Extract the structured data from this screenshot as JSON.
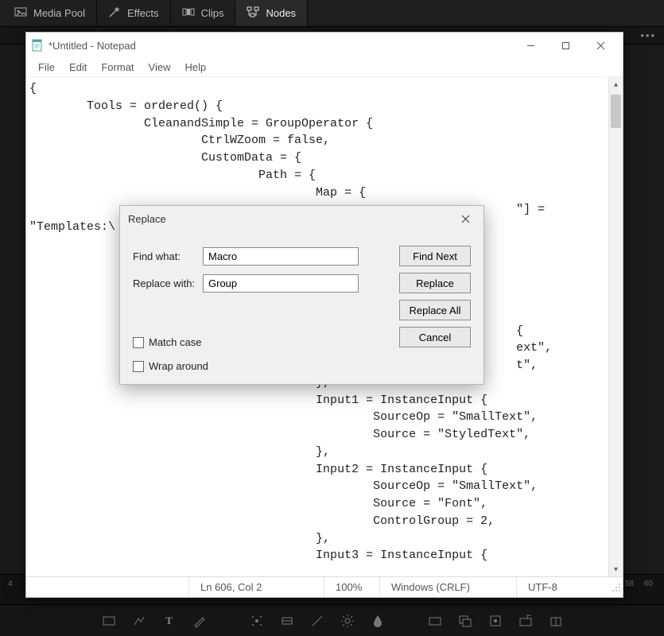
{
  "app_tabs": {
    "media_pool": "Media Pool",
    "effects": "Effects",
    "clips": "Clips",
    "nodes": "Nodes"
  },
  "notepad": {
    "title": "*Untitled - Notepad",
    "menu": {
      "file": "File",
      "edit": "Edit",
      "format": "Format",
      "view": "View",
      "help": "Help"
    },
    "content": "{\n        Tools = ordered() {\n                CleanandSimple = GroupOperator {\n                        CtrlWZoom = false,\n                        CustomData = {\n                                Path = {\n                                        Map = {\n                                                                    \"] =\n\"Templates:\\\n\n\n\n\n\n                                                                    {\n                                                                    ext\",\n                                                                    t\",\n                                        },\n                                        Input1 = InstanceInput {\n                                                SourceOp = \"SmallText\",\n                                                Source = \"StyledText\",\n                                        },\n                                        Input2 = InstanceInput {\n                                                SourceOp = \"SmallText\",\n                                                Source = \"Font\",\n                                                ControlGroup = 2,\n                                        },\n                                        Input3 = InstanceInput {",
    "status": {
      "position": "Ln 606, Col 2",
      "zoom": "100%",
      "line_ending": "Windows (CRLF)",
      "encoding": "UTF-8"
    }
  },
  "replace_dialog": {
    "title": "Replace",
    "find_label": "Find what:",
    "find_value": "Macro",
    "replace_label": "Replace with:",
    "replace_value": "Group",
    "find_next_btn": "Find Next",
    "replace_btn": "Replace",
    "replace_all_btn": "Replace All",
    "cancel_btn": "Cancel",
    "match_case": "Match case",
    "wrap_around": "Wrap around"
  },
  "timeline": {
    "left_num": "4",
    "num58": "58",
    "num60": "60"
  }
}
